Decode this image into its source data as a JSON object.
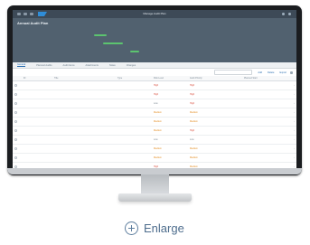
{
  "app": {
    "title": "Manage Audit Plan",
    "colors": {
      "shell": "#3d4a57",
      "header": "#51616f",
      "accent": "#2b6fb1",
      "kpi_green": "#5cc46f",
      "warning": "#e28a1d",
      "critical": "#d84a3a",
      "success": "#56a34a"
    }
  },
  "shell": {
    "icons": [
      "menu-icon",
      "back-icon",
      "home-icon",
      "sap-logo"
    ],
    "right_icons": [
      "search-icon",
      "user-icon"
    ]
  },
  "header": {
    "title": "Annual Audit Plan",
    "subtitle": "",
    "fields": [
      {
        "label": "",
        "value": ""
      }
    ],
    "kpis": [
      {
        "label": "",
        "value": ""
      },
      {
        "label": "",
        "value": ""
      },
      {
        "label": "",
        "value": ""
      }
    ]
  },
  "tabs": [
    {
      "label": "General"
    },
    {
      "label": "Planned Audits"
    },
    {
      "label": "Audit Items"
    },
    {
      "label": "Attachments"
    },
    {
      "label": "Notes"
    },
    {
      "label": "Changes"
    }
  ],
  "toolbar": {
    "search_placeholder": "Search",
    "buttons": [
      {
        "label": "Add"
      },
      {
        "label": "Delete"
      },
      {
        "label": "Export"
      }
    ]
  },
  "table": {
    "columns": [
      "",
      "ID",
      "Title",
      "Type",
      "Risk Level",
      "Audit Priority",
      "Planned Start",
      ""
    ],
    "rows": [
      {
        "id": "",
        "title": "",
        "type": "",
        "risk": "High",
        "risk_class": "crit",
        "priority": "High",
        "priority_class": "crit",
        "date": ""
      },
      {
        "id": "",
        "title": "",
        "type": "",
        "risk": "High",
        "risk_class": "crit",
        "priority": "High",
        "priority_class": "crit",
        "date": ""
      },
      {
        "id": "",
        "title": "",
        "type": "",
        "risk": "Low",
        "risk_class": "info",
        "priority": "High",
        "priority_class": "crit",
        "date": ""
      },
      {
        "id": "",
        "title": "",
        "type": "",
        "risk": "Medium",
        "risk_class": "warn",
        "priority": "Medium",
        "priority_class": "warn",
        "date": ""
      },
      {
        "id": "",
        "title": "",
        "type": "",
        "risk": "Medium",
        "risk_class": "warn",
        "priority": "Medium",
        "priority_class": "warn",
        "date": ""
      },
      {
        "id": "",
        "title": "",
        "type": "",
        "risk": "Medium",
        "risk_class": "warn",
        "priority": "High",
        "priority_class": "crit",
        "date": ""
      },
      {
        "id": "",
        "title": "",
        "type": "",
        "risk": "Low",
        "risk_class": "info",
        "priority": "Low",
        "priority_class": "info",
        "date": ""
      },
      {
        "id": "",
        "title": "",
        "type": "",
        "risk": "Medium",
        "risk_class": "warn",
        "priority": "Medium",
        "priority_class": "warn",
        "date": ""
      },
      {
        "id": "",
        "title": "",
        "type": "",
        "risk": "Medium",
        "risk_class": "warn",
        "priority": "Medium",
        "priority_class": "warn",
        "date": ""
      },
      {
        "id": "",
        "title": "",
        "type": "",
        "risk": "High",
        "risk_class": "crit",
        "priority": "Medium",
        "priority_class": "warn",
        "date": ""
      },
      {
        "id": "",
        "title": "",
        "type": "",
        "risk": "High",
        "risk_class": "crit",
        "priority": "High",
        "priority_class": "crit",
        "date": ""
      },
      {
        "id": "",
        "title": "",
        "type": "",
        "risk": "Low",
        "risk_class": "info",
        "priority": "High",
        "priority_class": "crit",
        "date": ""
      }
    ]
  },
  "enlarge": {
    "label": "Enlarge",
    "icon": "plus-circle-icon"
  }
}
